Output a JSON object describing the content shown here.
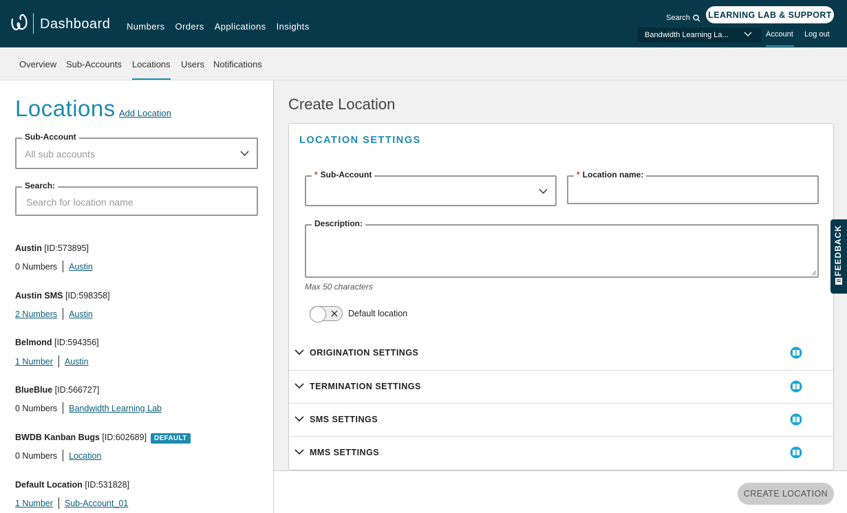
{
  "header": {
    "brand": "Dashboard",
    "nav": [
      "Numbers",
      "Orders",
      "Applications",
      "Insights"
    ],
    "search_label": "Search",
    "support_button": "LEARNING LAB & SUPPORT",
    "account_selector": "Bandwidth Learning La...",
    "account_link": "Account",
    "logout_link": "Log out",
    "colors": {
      "bar": "#07394b",
      "accent": "#1d8ab0"
    }
  },
  "subnav": {
    "items": [
      "Overview",
      "Sub-Accounts",
      "Locations",
      "Users",
      "Notifications"
    ],
    "active": "Locations"
  },
  "left": {
    "title": "Locations",
    "add_link": "Add Location",
    "subaccount_label": "Sub-Account",
    "subaccount_value": "All sub accounts",
    "search_label": "Search:",
    "search_placeholder": "Search for location name",
    "locations": [
      {
        "name": "Austin",
        "id": "[ID:573895]",
        "numbers": "0 Numbers",
        "numbers_link": false,
        "sub": "Austin",
        "badge": ""
      },
      {
        "name": "Austin SMS",
        "id": "[ID:598358]",
        "numbers": "2 Numbers",
        "numbers_link": true,
        "sub": "Austin",
        "badge": ""
      },
      {
        "name": "Belmond",
        "id": "[ID:594356]",
        "numbers": "1 Number",
        "numbers_link": true,
        "sub": "Austin",
        "badge": ""
      },
      {
        "name": "BlueBlue",
        "id": "[ID:566727]",
        "numbers": "0 Numbers",
        "numbers_link": false,
        "sub": "Bandwidth Learning Lab",
        "badge": ""
      },
      {
        "name": "BWDB Kanban Bugs",
        "id": "[ID:602689]",
        "numbers": "0 Numbers",
        "numbers_link": false,
        "sub": "Location",
        "badge": "DEFAULT"
      },
      {
        "name": "Default Location",
        "id": "[ID:531828]",
        "numbers": "1 Number",
        "numbers_link": true,
        "sub": "Sub-Account_01",
        "badge": ""
      }
    ]
  },
  "right": {
    "title": "Create Location",
    "section_title": "LOCATION SETTINGS",
    "subaccount_label": "Sub-Account",
    "location_name_label": "Location name:",
    "description_label": "Description:",
    "description_hint": "Max 50 characters",
    "default_toggle_label": "Default location",
    "default_toggle_on": false,
    "accordions": [
      "ORIGINATION SETTINGS",
      "TERMINATION SETTINGS",
      "SMS SETTINGS",
      "MMS SETTINGS"
    ],
    "create_button": "CREATE LOCATION"
  },
  "feedback_tab": "FEEDBACK"
}
